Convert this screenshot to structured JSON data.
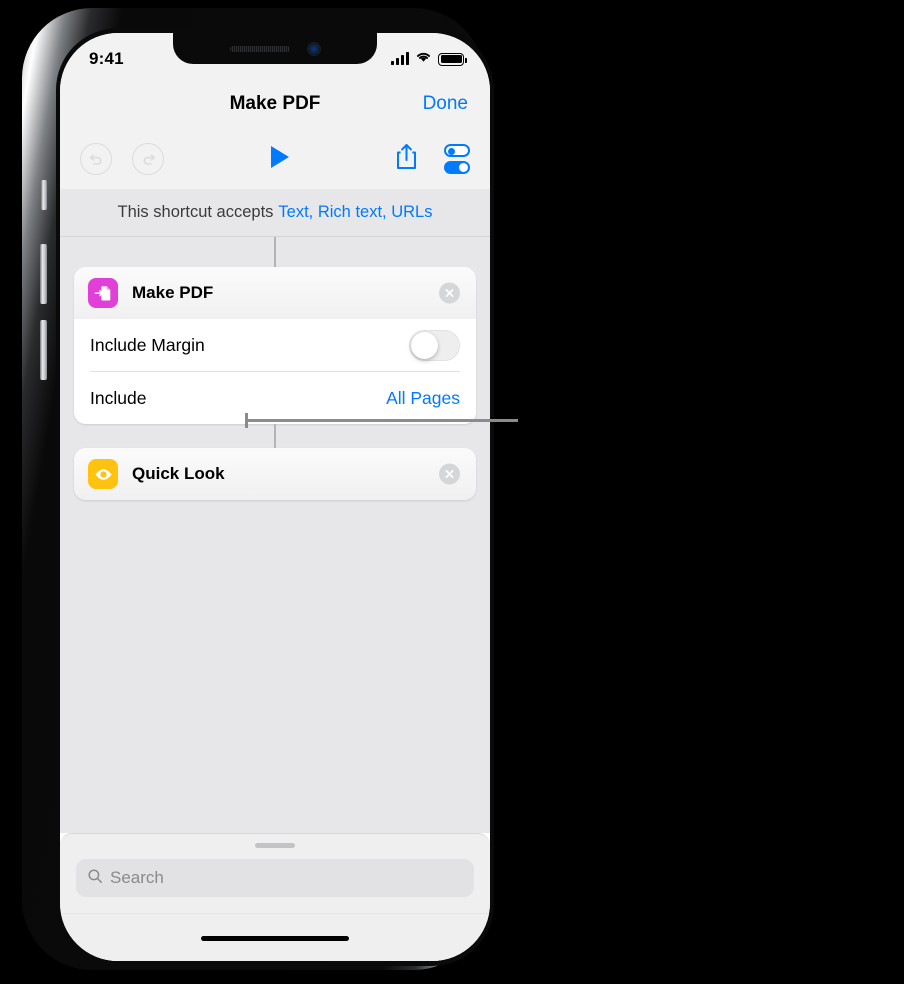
{
  "status_bar": {
    "time": "9:41",
    "cellular_icon": "signal-bars-icon",
    "wifi_icon": "wifi-icon",
    "battery_icon": "battery-full-icon"
  },
  "nav": {
    "title": "Make PDF",
    "done_label": "Done"
  },
  "toolbar": {
    "undo_icon": "undo-icon",
    "redo_icon": "redo-icon",
    "play_icon": "play-icon",
    "share_icon": "share-icon",
    "settings_icon": "shortcut-settings-toggles-icon"
  },
  "accepts_bar": {
    "prefix": "This shortcut accepts",
    "types": "Text, Rich text, URLs"
  },
  "workflow": {
    "actions": [
      {
        "title": "Make PDF",
        "icon_name": "make-pdf-icon",
        "icon_color": "#e040d8",
        "close_icon": "close-circle-icon",
        "parameters": [
          {
            "label": "Include Margin",
            "control": "switch",
            "value": "off"
          },
          {
            "label": "Include",
            "control": "value",
            "value": "All Pages"
          }
        ]
      },
      {
        "title": "Quick Look",
        "icon_name": "quick-look-eye-icon",
        "icon_color": "#ffc20e",
        "close_icon": "close-circle-icon",
        "parameters": []
      }
    ]
  },
  "search": {
    "placeholder": "Search",
    "icon": "search-icon",
    "grabber": "sheet-grabber-handle"
  },
  "colors": {
    "accent_blue": "#007aff",
    "canvas_gray": "#e7e7e9",
    "chrome_gray": "#f2f2f2",
    "make_pdf_magenta": "#e040d8",
    "quick_look_yellow": "#ffc20e"
  }
}
